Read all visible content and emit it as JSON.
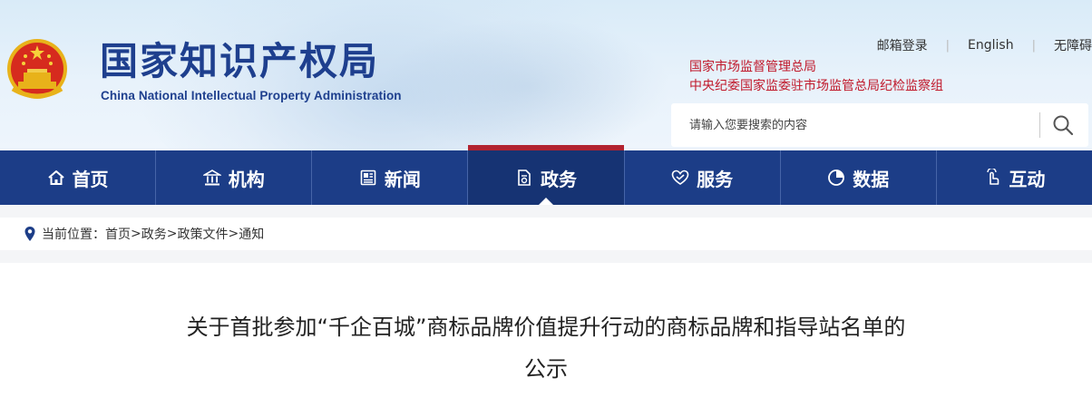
{
  "header": {
    "site_title": "国家知识产权局",
    "site_subtitle": "China National Intellectual Property Administration",
    "top_links": [
      "邮箱登录",
      "English",
      "无障碍"
    ],
    "org_links": [
      "国家市场监督管理总局",
      "中央纪委国家监委驻市场监管总局纪检监察组"
    ],
    "search_placeholder": "请输入您要搜索的内容"
  },
  "nav": {
    "items": [
      {
        "label": "首页",
        "icon": "home-icon"
      },
      {
        "label": "机构",
        "icon": "institution-icon"
      },
      {
        "label": "新闻",
        "icon": "news-icon"
      },
      {
        "label": "政务",
        "icon": "government-affairs-icon",
        "active": true
      },
      {
        "label": "服务",
        "icon": "service-icon"
      },
      {
        "label": "数据",
        "icon": "data-pie-icon"
      },
      {
        "label": "互动",
        "icon": "interaction-icon"
      }
    ]
  },
  "breadcrumb": {
    "prefix": "当前位置：",
    "items": [
      "首页",
      "政务",
      "政策文件",
      "通知"
    ],
    "separator": ">"
  },
  "article": {
    "title_line1": "关于首批参加“千企百城”商标品牌价值提升行动的商标品牌和指导站名单的",
    "title_line2": "公示"
  },
  "colors": {
    "nav_bg": "#1c3d87",
    "nav_active_bg": "#163373",
    "nav_active_marker": "#b22330",
    "title_blue": "#1e3f8e",
    "org_red": "#c0182a"
  }
}
